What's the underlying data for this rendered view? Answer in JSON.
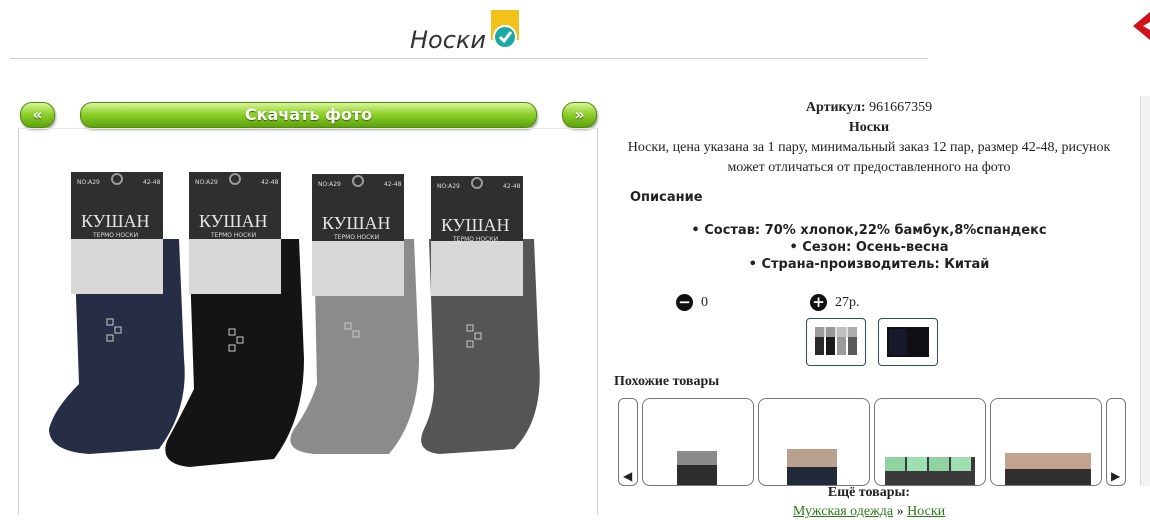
{
  "header": {
    "title": "Носки",
    "badge_icon": "verified-check-badge-icon",
    "close_icon": "close-icon"
  },
  "photo_nav": {
    "prev_label": "«",
    "download_label": "Скачать фото",
    "next_label": "»"
  },
  "product": {
    "article_label": "Артикул:",
    "article_value": "961667359",
    "name": "Носки",
    "description": "Носки, цена указана за 1 пару, минимальный заказ 12 пар, размер 42-48, рисунок может отличаться от предоставленного на фото",
    "description_heading": "Описание",
    "features": [
      "Состав: 70% хлопок,22% бамбук,8%спандекс",
      "Сезон: Осень-весна",
      "Страна-производитель: Китай"
    ],
    "photo_labels": {
      "brand": "КУШАН",
      "line": "ТЕРМО  НОСКИ",
      "model": "NO:A29",
      "size": "42-48"
    }
  },
  "quantity": {
    "value": "0",
    "price": "27р.",
    "minus_icon": "minus-circle-icon",
    "plus_icon": "plus-circle-icon"
  },
  "variants": [
    {
      "name": "variant-grey-socks"
    },
    {
      "name": "variant-dark-socks"
    }
  ],
  "similar": {
    "title": "Похожие товары",
    "left_icon": "scroll-left-icon",
    "right_icon": "scroll-right-icon",
    "left_glyph": "◀",
    "right_glyph": "▶"
  },
  "more": {
    "title": "Ещё товары:",
    "crumbs": [
      "Мужская одежда",
      "Носки"
    ],
    "separator": "»"
  },
  "colors": {
    "accent_green": "#6cb418",
    "link_green": "#2a7a16",
    "close_red": "#d0101a",
    "badge_yellow": "#f2c21b",
    "badge_teal": "#1aa9a5"
  }
}
